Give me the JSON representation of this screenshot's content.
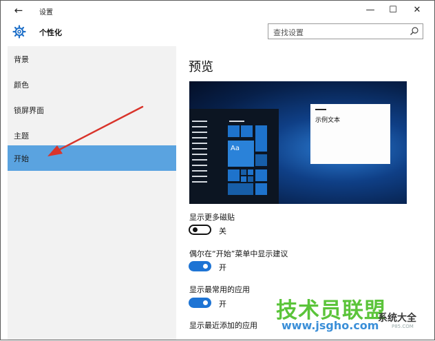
{
  "window": {
    "back_glyph": "←",
    "title": "设置",
    "minimize_glyph": "—",
    "maximize_glyph": "☐",
    "close_glyph": "✕"
  },
  "header": {
    "icon": "gear-icon",
    "title": "个性化",
    "search_placeholder": "查找设置",
    "search_icon": "search-icon"
  },
  "sidebar": {
    "items": [
      {
        "label": "背景"
      },
      {
        "label": "颜色"
      },
      {
        "label": "锁屏界面"
      },
      {
        "label": "主题"
      },
      {
        "label": "开始",
        "active": true
      }
    ],
    "active_color": "#5aa3e0",
    "annotation": "red-arrow-pointing-at-开始"
  },
  "main": {
    "preview_title": "预览",
    "preview": {
      "tile_label": "Aa",
      "window_text": "示例文本"
    },
    "options": [
      {
        "label": "显示更多磁贴",
        "state": "关",
        "on": false
      },
      {
        "label": "偶尔在“开始”菜单中显示建议",
        "state": "开",
        "on": true
      },
      {
        "label": "显示最常用的应用",
        "state": "开",
        "on": true
      },
      {
        "label": "显示最近添加的应用"
      }
    ],
    "accent_color": "#1e74d4"
  },
  "watermark": {
    "big": "技术员联盟",
    "site": "www.jsgho.com",
    "small": "系统大全",
    "tiny": "P85.COM"
  }
}
